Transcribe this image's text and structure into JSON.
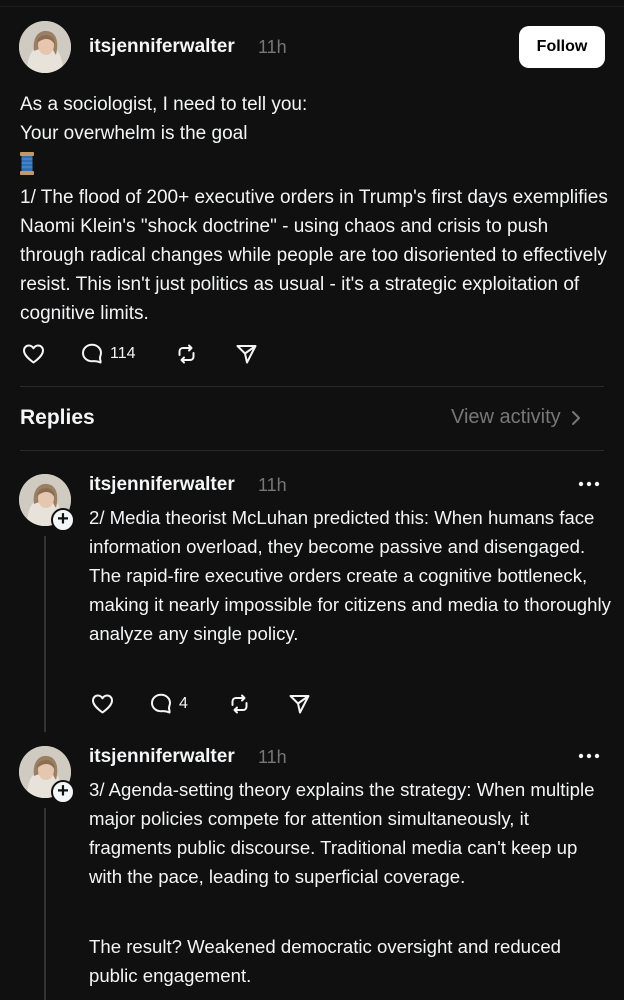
{
  "post": {
    "username": "itsjenniferwalter",
    "time": "11h",
    "follow_label": "Follow",
    "lines": [
      "As a sociologist, I need to tell you:",
      "Your overwhelm is the goal"
    ],
    "thread_emoji_icon": "spool-of-thread-icon",
    "body": "1/ The flood of 200+ executive orders in Trump's first days exemplifies Naomi Klein's \"shock doctrine\" - using chaos and crisis to push through radical changes while people are too disoriented to effectively resist. This isn't just politics as usual - it's a strategic exploitation of cognitive limits.",
    "actions": {
      "like_icon": "heart-icon",
      "comment_icon": "comment-icon",
      "comment_count": "114",
      "repost_icon": "repost-icon",
      "share_icon": "send-icon"
    }
  },
  "replies_header": {
    "label": "Replies",
    "view_activity": "View activity"
  },
  "replies": [
    {
      "username": "itsjenniferwalter",
      "time": "11h",
      "text": "2/ Media theorist McLuhan predicted this: When humans face information overload, they become passive and disengaged. The rapid-fire executive orders create a cognitive bottleneck, making it nearly impossible for citizens and media to thoroughly analyze any single policy.",
      "comment_count": "4"
    },
    {
      "username": "itsjenniferwalter",
      "time": "11h",
      "text": "3/ Agenda-setting theory explains the strategy: When multiple major policies compete for attention simultaneously, it fragments public discourse. Traditional media can't keep up with the pace, leading to superficial coverage.",
      "text2": "The result? Weakened democratic oversight and reduced public engagement."
    }
  ],
  "colors": {
    "background": "#101010",
    "text": "#f3f5f7",
    "secondary": "#777777",
    "button": "#ffffff"
  }
}
